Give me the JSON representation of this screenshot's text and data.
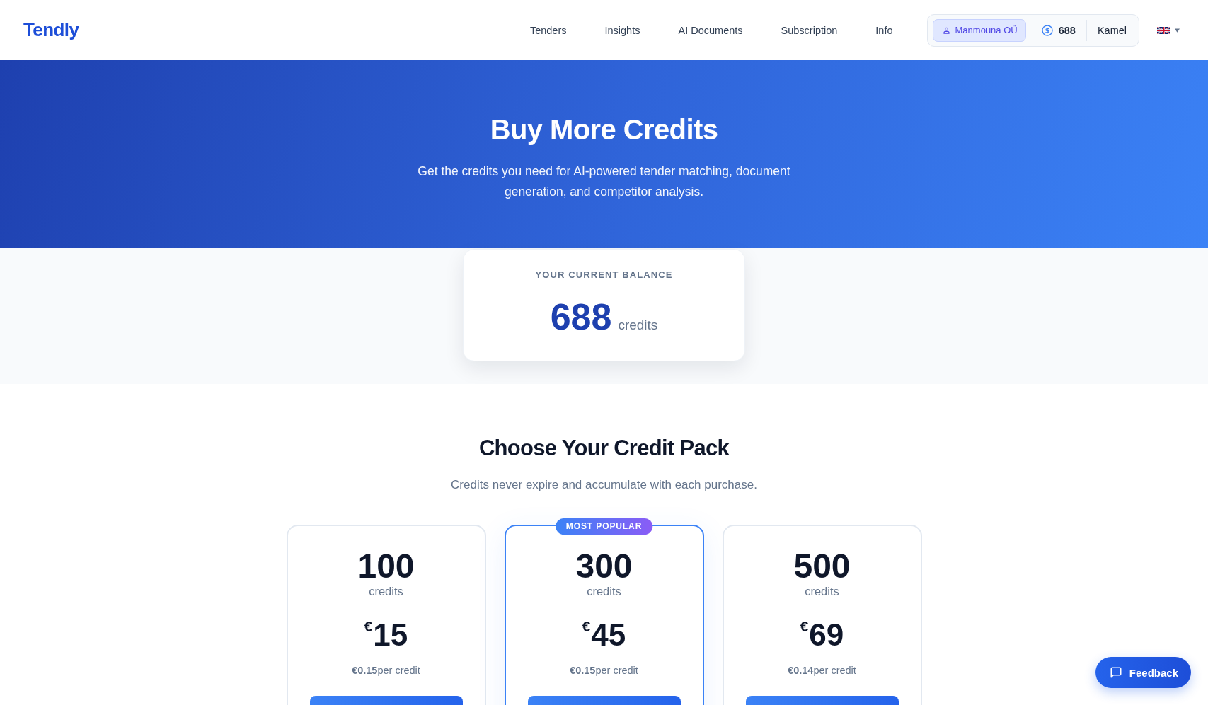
{
  "header": {
    "logo": "Tendly",
    "nav": [
      "Tenders",
      "Insights",
      "AI Documents",
      "Subscription",
      "Info"
    ],
    "account": {
      "organization": "Manmouna OÜ",
      "credits": "688",
      "user": "Kamel"
    }
  },
  "hero": {
    "title": "Buy More Credits",
    "subtitle": "Get the credits you need for AI-powered tender matching, document generation, and competitor analysis."
  },
  "balance": {
    "label": "YOUR CURRENT BALANCE",
    "amount": "688",
    "unit": "credits"
  },
  "packs": {
    "title": "Choose Your Credit Pack",
    "subtitle": "Credits never expire and accumulate with each purchase.",
    "items": [
      {
        "credits": "100",
        "unit": "credits",
        "price": "$^{€}$15",
        "per_credit": "**€0.15**per credit",
        "featured": false
      },
      {
        "credits": "300",
        "unit": "credits",
        "price": "$^{€}$45",
        "per_credit": "**€0.15**per credit",
        "featured": true,
        "badge": "MOST POPULAR"
      },
      {
        "credits": "500",
        "unit": "credits",
        "price": "$^{€}$69",
        "per_credit": "**€0.14**per credit",
        "featured": false
      }
    ]
  },
  "feedback_button": {
    "label": "Feedback"
  }
}
